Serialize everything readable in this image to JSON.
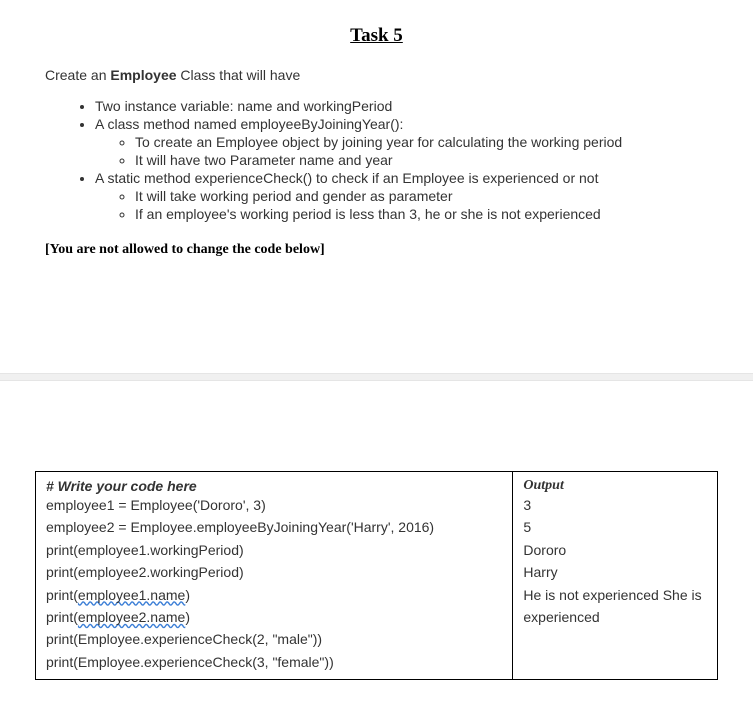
{
  "title": "Task 5",
  "intro_prefix": "Create an ",
  "intro_bold": "Employee",
  "intro_suffix": " Class that will have",
  "bullets": {
    "b1": "Two instance variable: name and workingPeriod",
    "b2": "A class method named employeeByJoiningYear():",
    "b2a": "To create an Employee object by joining year for calculating the working period",
    "b2b": "It will have two Parameter name and year",
    "b3": "A static method experienceCheck() to check if an Employee is experienced or not",
    "b3a": "It will take working period and gender as parameter",
    "b3b": "If an employee's working period is less than 3, he or she is not experienced"
  },
  "note": "[You are not allowed to change the code below]",
  "code": {
    "heading": "# Write your code here",
    "line1": "employee1 = Employee('Dororo', 3)",
    "line2": "employee2 = Employee.employeeByJoiningYear('Harry', 2016) print(employee1.workingPeriod)",
    "line3": "print(employee2.workingPeriod)",
    "line4a": "print(",
    "line4b": "employee1.name",
    "line4c": ")",
    "line5a": "print(",
    "line5b": "employee2.name",
    "line5c": ")",
    "line6": "print(Employee.experienceCheck(2, \"male\"))",
    "line7": "print(Employee.experienceCheck(3, \"female\"))"
  },
  "output": {
    "heading": "Output",
    "l1": "3",
    "l2": "5",
    "l3": "Dororo",
    "l4": "Harry",
    "l5": "He is not experienced She is experienced"
  }
}
